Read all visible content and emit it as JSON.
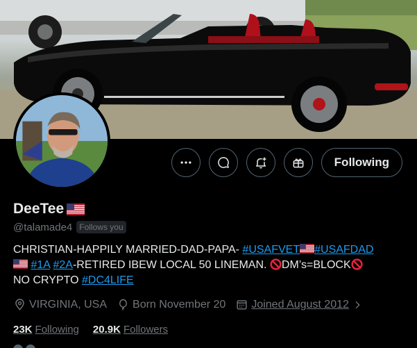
{
  "profile": {
    "display_name": "DeeTee",
    "handle": "@talamade4",
    "follows_you": "Follows you",
    "follow_button": "Following"
  },
  "bio": {
    "part1": "CHRISTIAN-HAPPILY MARRIED-DAD-PAPA- ",
    "tag1": "#USAFVET",
    "tag2": "#USAFDAD",
    "space1": " ",
    "tag3": "#1A",
    "space2": " ",
    "tag4": "#2A",
    "part2": "-RETIRED IBEW LOCAL 50 LINEMAN. ",
    "part3": "DM’s=BLOCK",
    "part4": "NO CRYPTO  ",
    "tag5": "#DC4LIFE"
  },
  "meta": {
    "location": "VIRGINIA, USA",
    "birthday": "Born November 20",
    "joined": "Joined August 2012"
  },
  "stats": {
    "following_count": "23K",
    "following_label": "Following",
    "followers_count": "20.9K",
    "followers_label": "Followers"
  },
  "icons": {
    "more": "more-icon",
    "message": "message-icon",
    "notify": "bell-plus-icon",
    "subscribe": "gift-icon",
    "location": "location-pin-icon",
    "birthday": "balloon-icon",
    "calendar": "calendar-icon"
  },
  "colors": {
    "background": "#000000",
    "text": "#e7e9ea",
    "muted": "#71767b",
    "link": "#1d9bf0",
    "border": "#536471"
  }
}
